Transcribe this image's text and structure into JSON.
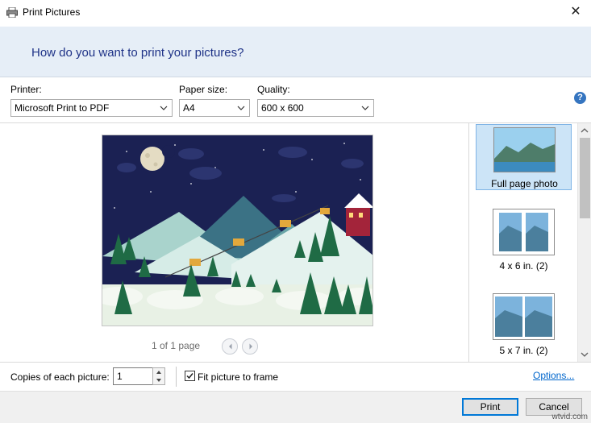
{
  "window": {
    "title": "Print Pictures",
    "close_glyph": "✕",
    "app_icon": "printer-icon"
  },
  "header": {
    "question": "How do you want to print your pictures?"
  },
  "printer": {
    "label": "Printer:",
    "value": "Microsoft Print to PDF"
  },
  "paper_size": {
    "label": "Paper size:",
    "value": "A4"
  },
  "quality": {
    "label": "Quality:",
    "value": "600 x 600"
  },
  "help": {
    "glyph": "?"
  },
  "preview": {
    "page_counter": "1 of 1 page"
  },
  "layouts": [
    {
      "label": "Full page photo",
      "selected": true
    },
    {
      "label": "4 x 6 in. (2)",
      "selected": false
    },
    {
      "label": "5 x 7 in. (2)",
      "selected": false
    }
  ],
  "copies": {
    "label": "Copies of each picture:",
    "value": "1"
  },
  "fit": {
    "label": "Fit picture to frame",
    "checked": true
  },
  "options_link": "Options...",
  "footer": {
    "print_label": "Print",
    "cancel_label": "Cancel"
  },
  "watermark": "wtvid.com",
  "colors": {
    "header_bg": "#e6eef7",
    "accent": "#0078d7",
    "link": "#0066cc",
    "night_sky": "#1b2153"
  }
}
